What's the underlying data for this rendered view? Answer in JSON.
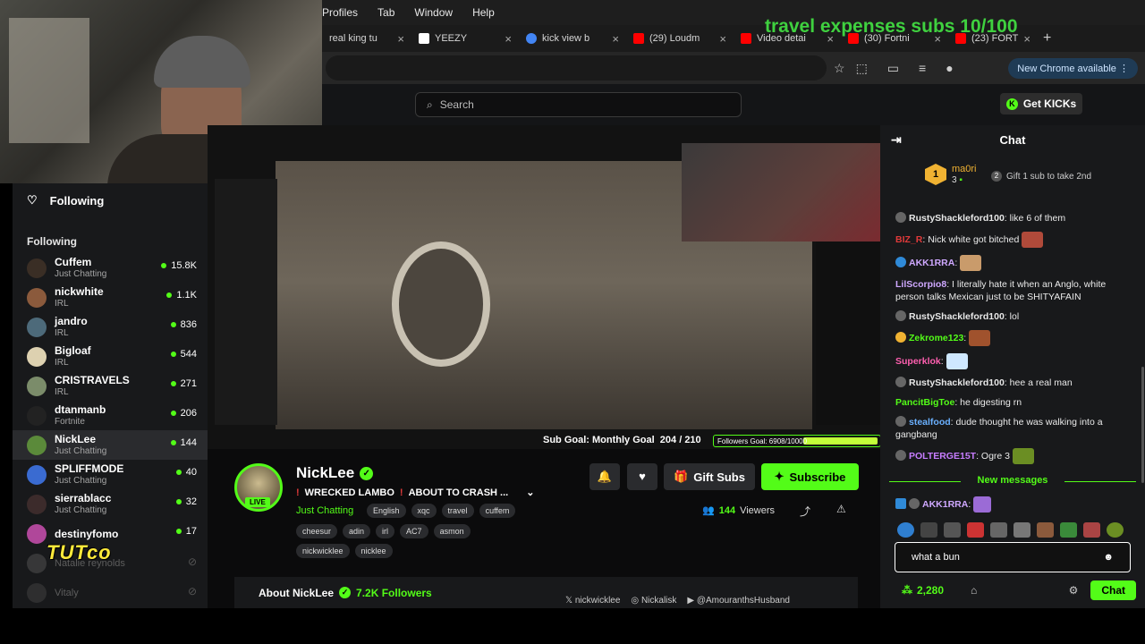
{
  "overlay": {
    "title": "travel expenses subs 10/100",
    "tutco": "TUTco"
  },
  "menubar": {
    "items": [
      "Profiles",
      "Tab",
      "Window",
      "Help"
    ]
  },
  "tabs": [
    {
      "label": "real king tu",
      "color": "#000000"
    },
    {
      "label": "YEEZY",
      "color": "#ffffff"
    },
    {
      "label": "kick view b",
      "color": "#4285f4"
    },
    {
      "label": "(29) Loudm",
      "color": "#ff0000"
    },
    {
      "label": "Video detai",
      "color": "#ff0000"
    },
    {
      "label": "(30) Fortni",
      "color": "#ff0000"
    },
    {
      "label": "(23) FORT",
      "color": "#ff0000"
    }
  ],
  "browser": {
    "new_chrome": "New Chrome available"
  },
  "site": {
    "search_placeholder": "Search",
    "get_kicks": "Get KICKs"
  },
  "sidebar": {
    "following_nav": "Following",
    "section_title": "Following",
    "channels": [
      {
        "name": "Cuffem",
        "category": "Just Chatting",
        "viewers": "15.8K",
        "color": "#3a2e25",
        "active": false
      },
      {
        "name": "nickwhite",
        "category": "IRL",
        "viewers": "1.1K",
        "color": "#8b5a3c",
        "active": false
      },
      {
        "name": "jandro",
        "category": "IRL",
        "viewers": "836",
        "color": "#4d6a7a",
        "active": false
      },
      {
        "name": "Bigloaf",
        "category": "IRL",
        "viewers": "544",
        "color": "#ddd1b0",
        "active": false
      },
      {
        "name": "CRISTRAVELS",
        "category": "IRL",
        "viewers": "271",
        "color": "#7b8c6a",
        "active": false
      },
      {
        "name": "dtanmanb",
        "category": "Fortnite",
        "viewers": "206",
        "color": "#222222",
        "active": false
      },
      {
        "name": "NickLee",
        "category": "Just Chatting",
        "viewers": "144",
        "color": "#5b8a3a",
        "active": true
      },
      {
        "name": "SPLIFFMODE",
        "category": "Just Chatting",
        "viewers": "40",
        "color": "#3a6bd1",
        "active": false
      },
      {
        "name": "sierrablacc",
        "category": "Just Chatting",
        "viewers": "32",
        "color": "#3c2b2b",
        "active": false
      },
      {
        "name": "destinyfomo",
        "category": "",
        "viewers": "17",
        "color": "#b0479a",
        "active": false
      }
    ],
    "offline": [
      {
        "name": "Natalie reynolds",
        "color": "#555555"
      },
      {
        "name": "Vitaly",
        "color": "#444444"
      }
    ]
  },
  "video": {
    "sub_goal": "Sub Goal: Monthly Goal",
    "sub_goal_value": "204 / 210",
    "followers_goal": "Followers Goal: 6908/10000",
    "followers_progress": 0.69
  },
  "stream": {
    "name": "NickLee",
    "live": "LIVE",
    "title": "WRECKED LAMBO",
    "title2": "ABOUT TO CRASH ...",
    "category": "Just Chatting",
    "tags_row1": [
      "English",
      "xqc",
      "travel",
      "cuffem"
    ],
    "tags_row2": [
      "cheesur",
      "adin",
      "irl",
      "AC7",
      "asmon"
    ],
    "tags_row3": [
      "nickwicklee",
      "nicklee"
    ],
    "gift_subs": "Gift Subs",
    "subscribe": "Subscribe",
    "viewers": "144",
    "viewers_label": "Viewers",
    "about": "About NickLee",
    "followers": "7.2K Followers",
    "socials": [
      "nickwicklee",
      "Nickalisk",
      "@AmouranthsHusband"
    ]
  },
  "chat": {
    "title": "Chat",
    "pinned_user": "ma0ri",
    "pinned_rank": "1",
    "pinned_count": "3",
    "pinned_gift": "Gift 1 sub to take 2nd",
    "pinned_gift_num": "2",
    "messages": [
      {
        "user": "RustyShackleford100",
        "color": "#e8e8e8",
        "text": "like 6 of them",
        "badge": "#666666"
      },
      {
        "user": "BIZ_R",
        "color": "#e03a3a",
        "text": "Nick white got bitched",
        "badge": "",
        "emote": "#b04a3a"
      },
      {
        "user": "AKK1RRA",
        "color": "#cfa8ff",
        "text": "",
        "badge": "#2f8ad8",
        "emote": "#c99b6b"
      },
      {
        "user": "LilScorpio8",
        "color": "#cfa8ff",
        "text": "I literally hate it when an Anglo, white person talks Mexican just to be SHITYAFAIN",
        "badge": ""
      },
      {
        "user": "RustyShackleford100",
        "color": "#e8e8e8",
        "text": "lol",
        "badge": "#666666"
      },
      {
        "user": "Zekrome123",
        "color": "#53fc18",
        "text": "",
        "badge": "#f0b232",
        "emote": "#a0522d"
      },
      {
        "user": "Superklok",
        "color": "#ff5fb0",
        "text": "",
        "badge": "",
        "emote": "#cfe8ff"
      },
      {
        "user": "RustyShackleford100",
        "color": "#e8e8e8",
        "text": "hee a real man",
        "badge": "#666666"
      },
      {
        "user": "PancitBigToe",
        "color": "#53fc18",
        "text": "he digesting rn",
        "badge": ""
      },
      {
        "user": "stealfood",
        "color": "#6ab0ff",
        "text": "dude thought he was walking into a gangbang",
        "badge": "#666666"
      },
      {
        "user": "POLTERGE15T",
        "color": "#c77dff",
        "text": "Ogre 3",
        "badge": "#666666",
        "emote": "#6b8e23"
      }
    ],
    "new_messages": "New messages",
    "last_user": "AKK1RRA",
    "input_value": "what a bun",
    "kicks_balance": "2,280",
    "send": "Chat"
  }
}
